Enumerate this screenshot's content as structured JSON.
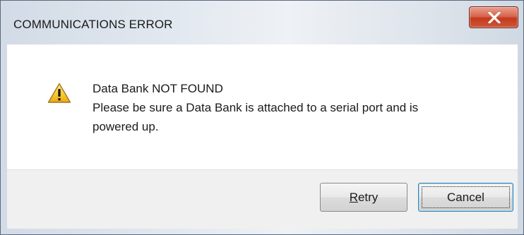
{
  "window": {
    "title": "COMMUNICATIONS ERROR",
    "close_glyph": "✕"
  },
  "message": {
    "icon": "warning-icon",
    "line1": "Data Bank NOT FOUND",
    "line2": "Please be sure a Data Bank is attached to a serial port and is",
    "line3": "powered up."
  },
  "buttons": {
    "retry_mnemonic": "R",
    "retry_rest": "etry",
    "cancel_label": "Cancel"
  },
  "colors": {
    "close_button": "#c4391e",
    "warning_fill": "#f7c731",
    "focus_border": "#3c7fb1"
  }
}
